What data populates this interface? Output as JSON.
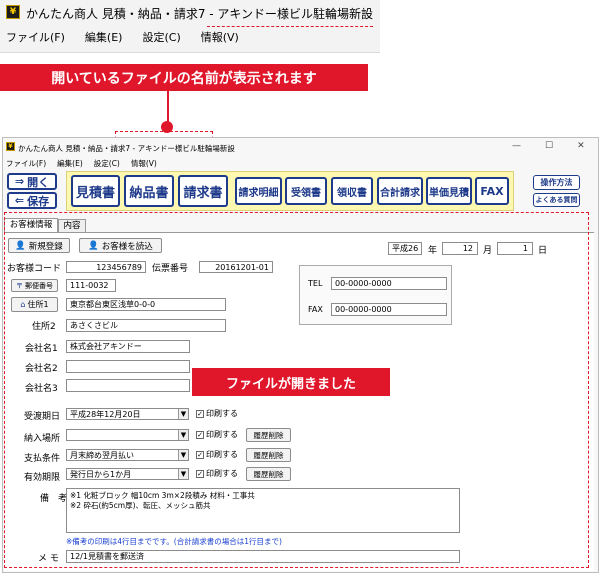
{
  "zoom_title": "かんたん商人 見積・納品・請求7 - アキンドー様ビル駐輪場新設",
  "zoom_menu": [
    "ファイル(F)",
    "編集(E)",
    "設定(C)",
    "情報(V)"
  ],
  "banner_top": "開いているファイルの名前が表示されます",
  "banner_mid": "ファイルが開きました",
  "app": {
    "title": "かんたん商人 見積・納品・請求7 - アキンドー様ビル駐輪場新設",
    "window_controls": [
      "—",
      "☐",
      "✕"
    ],
    "menu": [
      "ファイル(F)",
      "編集(E)",
      "設定(C)",
      "情報(V)"
    ],
    "toolbar": {
      "open": "開く",
      "save": "保存",
      "big": [
        "見積書",
        "納品書",
        "請求書"
      ],
      "mid": [
        "請求明細",
        "受領書",
        "領収書",
        "合計請求",
        "単価見積",
        "FAX"
      ],
      "help": "操作方法",
      "faq": "よくある質問"
    },
    "tabs": [
      "お客様情報",
      "内容"
    ],
    "customer": {
      "new_reg": "新規登録",
      "load": "お客様を読込",
      "era": "平成26",
      "year_label": "年",
      "month": "12",
      "month_label": "月",
      "day": "1",
      "day_label": "日",
      "code_label": "お客様コード",
      "code_value": "123456789",
      "slip_label": "伝票番号",
      "slip_value": "20161201-01",
      "postal_btn": "郵便番号",
      "postal_value": "111-0032",
      "addr1_btn": "住所1",
      "addr1_value": "東京都台東区浅草0-0-0",
      "addr2_label": "住所2",
      "addr2_value": "あさくさビル",
      "tel_label": "TEL",
      "tel_value": "00-0000-0000",
      "fax_label": "FAX",
      "fax_value": "00-0000-0000",
      "company1_label": "会社名1",
      "company1_value": "株式会社アキンドー",
      "company2_label": "会社名2",
      "company3_label": "会社名3"
    },
    "rows": [
      {
        "label": "受渡期日",
        "value": "平成28年12月20日",
        "print": "印刷する",
        "history": ""
      },
      {
        "label": "納入場所",
        "value": "",
        "print": "印刷する",
        "history": "履歴削除"
      },
      {
        "label": "支払条件",
        "value": "月末締め翌月払い",
        "print": "印刷する",
        "history": "履歴削除"
      },
      {
        "label": "有効期限",
        "value": "発行日から1か月",
        "print": "印刷する",
        "history": "履歴削除"
      }
    ],
    "remarks_label": "備　考",
    "remarks_lines": [
      "※1 化粧ブロック 幅10cm 3m×2段積み 材料・工事共",
      "※2 砕石(約5cm厚)、転圧、メッシュ筋共"
    ],
    "remarks_note": "※備考の印刷は4行目までです。(合計請求書の場合は1行目まで)",
    "memo_label": "メ モ",
    "memo_value": "12/1見積書を郵送済"
  }
}
